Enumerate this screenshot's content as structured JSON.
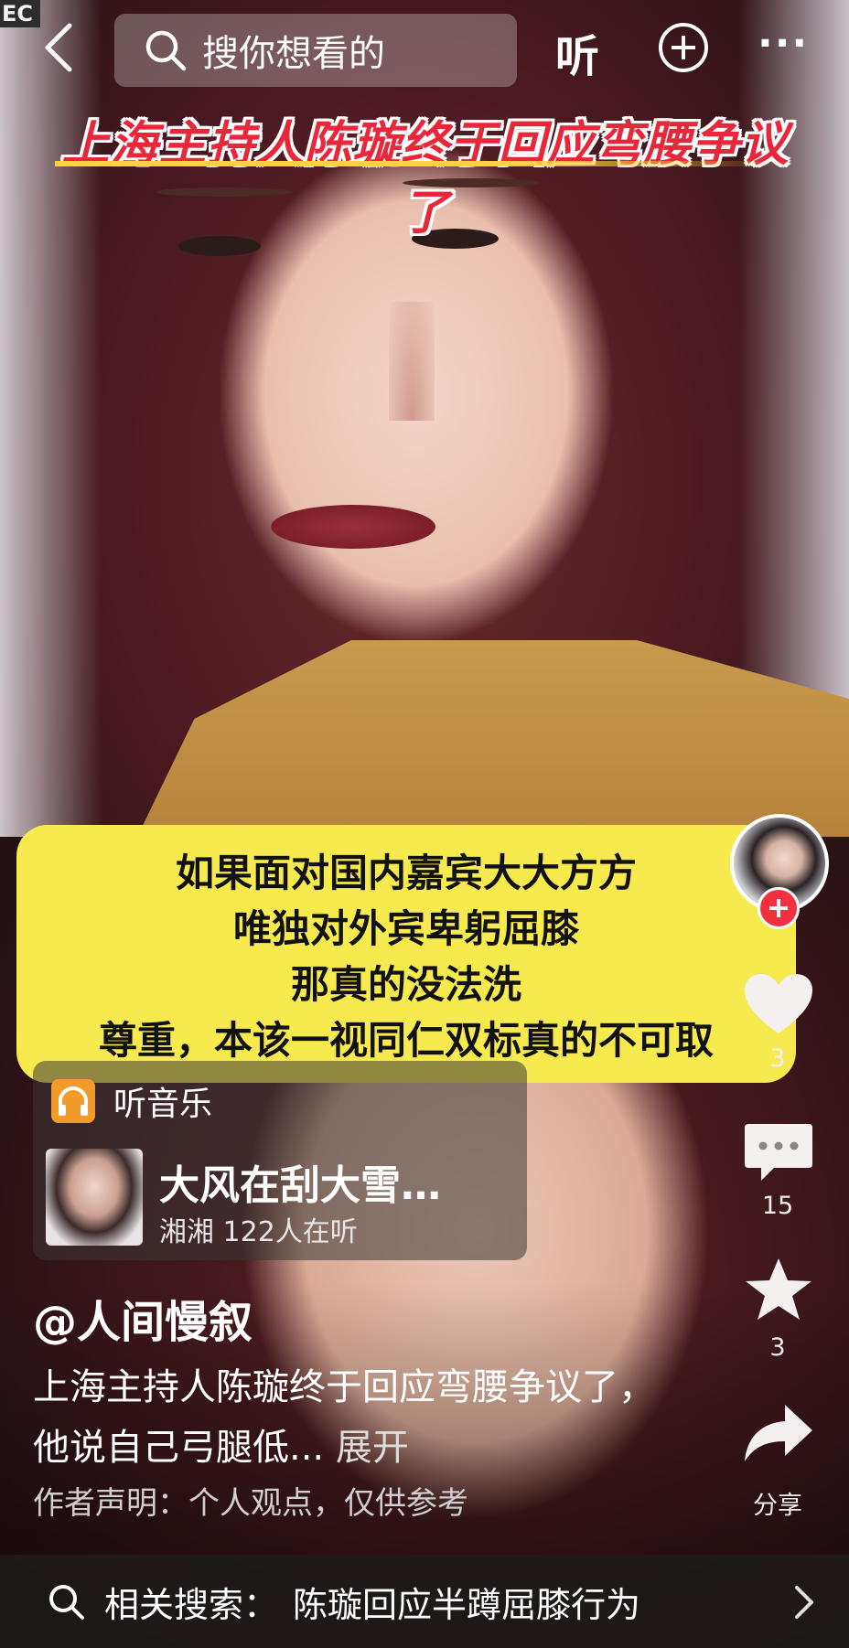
{
  "top_bar": {
    "corner_tag": "EC",
    "search_placeholder": "搜你想看的",
    "listen_label": "听",
    "more_label": "···"
  },
  "video": {
    "headline": "上海主持人陈璇终于回应弯腰争议了",
    "caption_lines": [
      "如果面对国内嘉宾大大方方",
      "唯独对外宾卑躬屈膝",
      "那真的没法洗",
      "尊重，本该一视同仁双标真的不可取"
    ]
  },
  "rail": {
    "like_count": "3",
    "comment_count": "15",
    "favorite_count": "3",
    "share_label": "分享"
  },
  "music": {
    "header": "听音乐",
    "title": "大风在刮大雪…",
    "meta": "湘湘 122人在听"
  },
  "post": {
    "author": "@人间慢叙",
    "description": "上海主持人陈璇终于回应弯腰争议了，他说自己弓腿低...",
    "expand_label": "展开",
    "disclaimer": "作者声明：个人观点，仅供参考"
  },
  "related_search": {
    "label": "相关搜索：",
    "query": "陈璇回应半蹲屈膝行为"
  },
  "colors": {
    "caption_bg": "#f7ea4f",
    "headline_red": "#e8283a",
    "follow_red": "#f23040",
    "music_icon": "#f29b2b"
  },
  "icons": [
    "back-icon",
    "search-icon",
    "plus-circle-icon",
    "heart-icon",
    "comment-icon",
    "star-icon",
    "share-icon",
    "headphones-icon",
    "chevron-right-icon"
  ]
}
